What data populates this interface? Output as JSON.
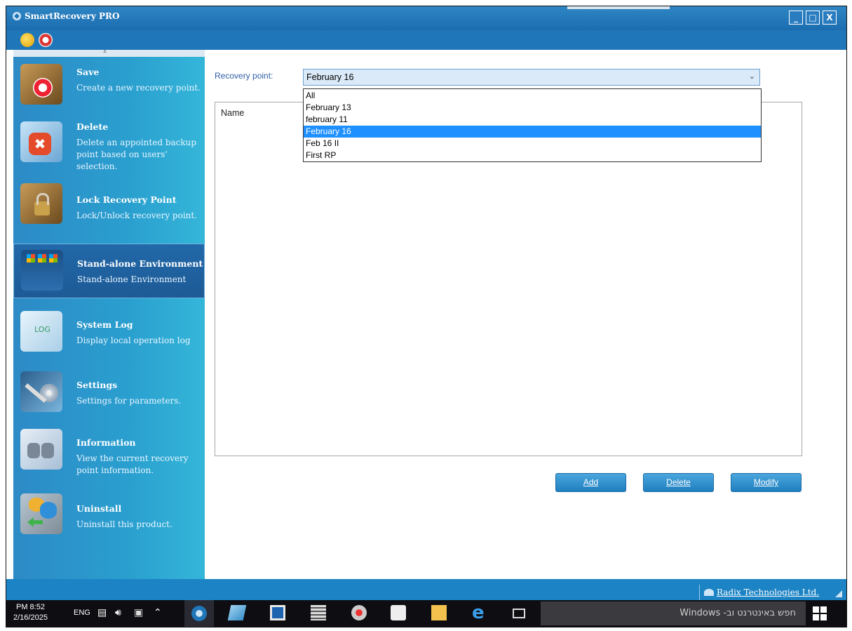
{
  "window": {
    "title": "SmartRecovery PRO",
    "controls": [
      "_",
      "□",
      "X"
    ]
  },
  "sidebar": {
    "items": [
      {
        "title": "Save",
        "desc": "Create a new recovery point.",
        "icon": "lifebuoy-icon"
      },
      {
        "title": "Delete",
        "desc": "Delete an appointed backup point based on users' selection.",
        "icon": "delete-icon"
      },
      {
        "title": "Lock Recovery Point",
        "desc": "Lock/Unlock recovery point.",
        "icon": "lock-icon"
      },
      {
        "title": "Stand-alone Environment",
        "desc": "Stand-alone Environment",
        "icon": "windows-computer-icon"
      },
      {
        "title": "System Log",
        "desc": "Display local operation log",
        "icon": "log-folder-icon",
        "icon_text": "LOG"
      },
      {
        "title": "Settings",
        "desc": "Settings for parameters.",
        "icon": "tools-icon"
      },
      {
        "title": "Information",
        "desc": "View the current recovery point information.",
        "icon": "binoculars-icon"
      },
      {
        "title": "Uninstall",
        "desc": "Uninstall this product.",
        "icon": "uninstall-icon"
      }
    ],
    "selected_index": 3
  },
  "main": {
    "recovery_point_label": "Recovery point:",
    "recovery_point_value": "February 16",
    "dropdown_options": [
      "All",
      "February 13",
      "february 11",
      "February 16",
      "Feb 16 II",
      "First RP"
    ],
    "dropdown_selected": "February 16",
    "list_column": "Name",
    "buttons": {
      "add": "Add",
      "delete": "Delete",
      "modify": "Modify"
    }
  },
  "status": {
    "company_link": "Radix Technologies Ltd."
  },
  "taskbar": {
    "time": "PM 8:52",
    "date": "2/16/2025",
    "language": "ENG",
    "search_placeholder": "חפש באינטרנט וב- Windows"
  },
  "colors": {
    "accent": "#1f76b8",
    "selection": "#1e90ff",
    "sidebar": "#2a9fcf"
  }
}
